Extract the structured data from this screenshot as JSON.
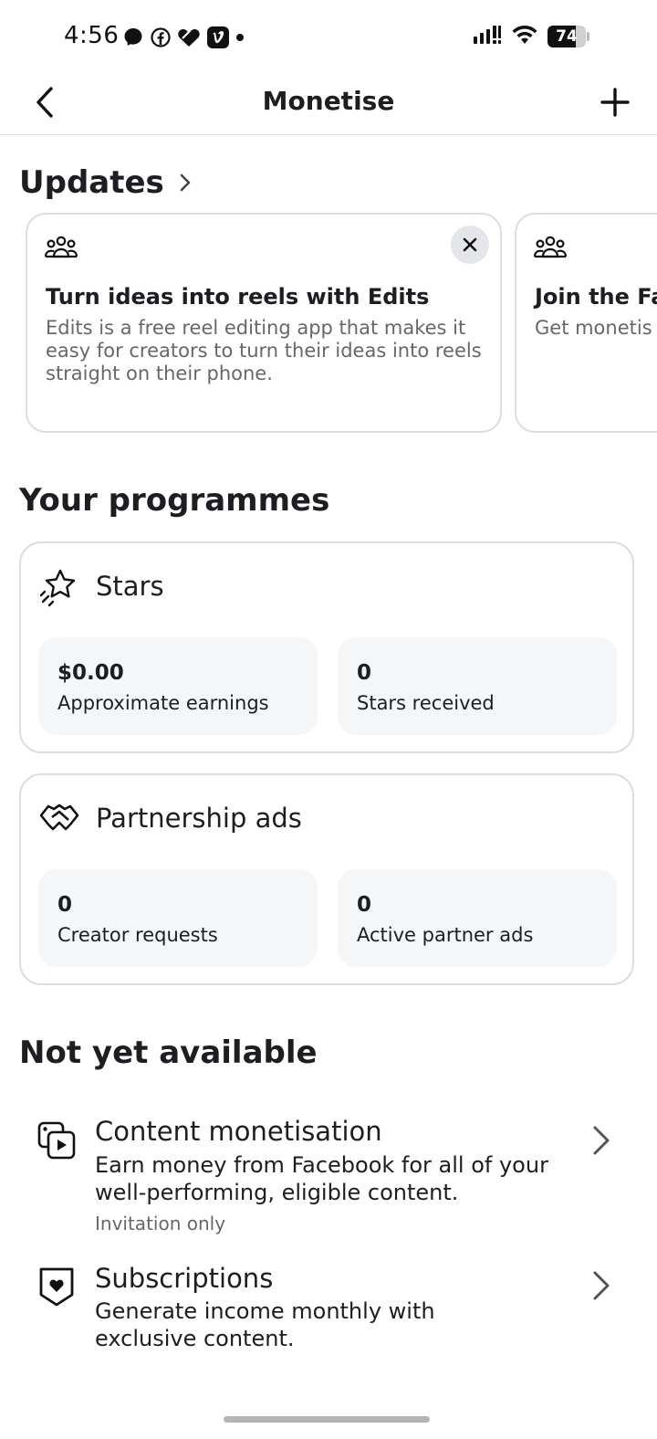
{
  "status_bar": {
    "time": "4:56",
    "battery_level": "74",
    "left_icons": [
      "messenger-icon",
      "facebook-icon",
      "heart-icon",
      "vimeo-icon",
      "dot-icon"
    ],
    "right_icons": [
      "signal-icon",
      "wifi-icon",
      "battery-icon"
    ]
  },
  "header": {
    "title": "Monetise",
    "back_icon": "chevron-left-icon",
    "add_icon": "plus-icon"
  },
  "updates": {
    "heading": "Updates",
    "cards": [
      {
        "icon": "group-icon",
        "title": "Turn ideas into reels with Edits",
        "body": "Edits is a free reel editing app that makes it easy for creators to turn their ideas into reels straight on their phone."
      },
      {
        "icon": "group-icon",
        "title": "Join the Fa",
        "body": "Get monetis and more fro"
      }
    ]
  },
  "programmes": {
    "heading": "Your programmes",
    "items": [
      {
        "name": "Stars",
        "icon": "star-icon",
        "stats": [
          {
            "value": "$0.00",
            "label": "Approximate earnings"
          },
          {
            "value": "0",
            "label": "Stars received"
          }
        ]
      },
      {
        "name": "Partnership ads",
        "icon": "handshake-icon",
        "stats": [
          {
            "value": "0",
            "label": "Creator requests"
          },
          {
            "value": "0",
            "label": "Active partner ads"
          }
        ]
      }
    ]
  },
  "not_available": {
    "heading": "Not yet available",
    "items": [
      {
        "title": "Content monetisation",
        "description": "Earn money from Facebook for all of your well-performing, eligible content.",
        "note": "Invitation only",
        "icon": "content-play-icon"
      },
      {
        "title": "Subscriptions",
        "description": "Generate income monthly with exclusive content.",
        "icon": "subscription-badge-icon"
      }
    ]
  },
  "colors": {
    "text_primary": "#1c1e21",
    "text_secondary": "#65676b",
    "border": "#dadde1",
    "stat_bg": "#f5f6f8"
  }
}
